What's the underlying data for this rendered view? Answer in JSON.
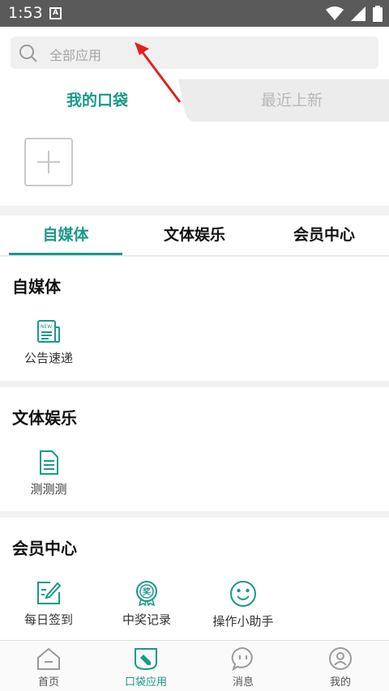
{
  "status_bar": {
    "time": "1:53",
    "notification_letter": "A"
  },
  "search": {
    "placeholder": "全部应用"
  },
  "pocket_tabs": {
    "left": "我的口袋",
    "right": "最近上新"
  },
  "category_tabs": [
    {
      "label": "自媒体",
      "active": true
    },
    {
      "label": "文体娱乐",
      "active": false
    },
    {
      "label": "会员中心",
      "active": false
    }
  ],
  "sections": [
    {
      "title": "自媒体",
      "items": [
        {
          "label": "公告速递",
          "icon": "newspaper-icon"
        }
      ]
    },
    {
      "title": "文体娱乐",
      "items": [
        {
          "label": "测测测",
          "icon": "document-icon"
        }
      ]
    },
    {
      "title": "会员中心",
      "items": [
        {
          "label": "每日签到",
          "icon": "sign-in-icon"
        },
        {
          "label": "中奖记录",
          "icon": "award-icon"
        },
        {
          "label": "操作小助手",
          "icon": "smiley-icon"
        }
      ]
    }
  ],
  "bottom_nav": [
    {
      "label": "首页",
      "icon": "home-icon",
      "active": false
    },
    {
      "label": "口袋应用",
      "icon": "pocket-apps-icon",
      "active": true
    },
    {
      "label": "消息",
      "icon": "message-icon",
      "active": false
    },
    {
      "label": "我的",
      "icon": "profile-icon",
      "active": false
    }
  ],
  "colors": {
    "accent": "#1a9988",
    "status_bar": "#5a5a5a",
    "annotation": "#e02020"
  }
}
